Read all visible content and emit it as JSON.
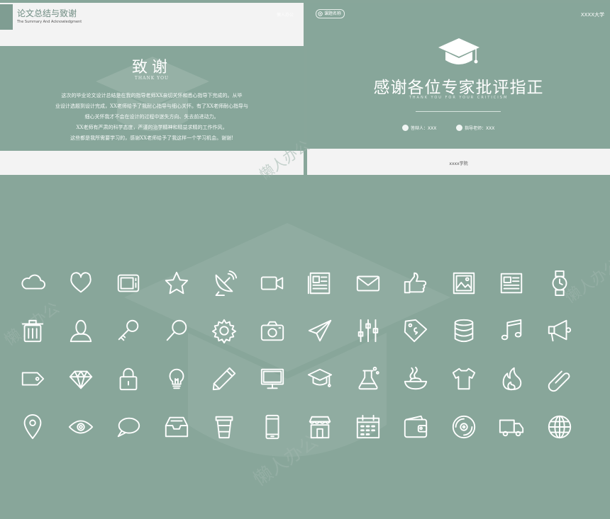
{
  "left_slide": {
    "title": "论文总结与致谢",
    "subtitle": "The Summary And Acknowledgment",
    "corner_tag": "懒人办公",
    "heading": "致谢",
    "heading_en": "THANK YOU",
    "body_lines": [
      "这次的毕业论文设计总结是在我的指导老师XX亲切关怀和悉心指导下完成的。从毕",
      "业设计选题到设计完成，XX老师给予了我耐心指导与细心关怀。有了XX老师耐心指导与",
      "细心关怀我才不会在设计的过程中迷失方向、失去前进动力。",
      "XX老师有严肃的科学态度，严谨的治学精神和精益求精的工作作风，",
      "这些都是我所需要学习的，感谢XX老师给予了我这样一个学习机会。谢谢!"
    ]
  },
  "right_slide": {
    "tag": "课题名称",
    "university": "XXXX大学",
    "title": "感谢各位专家批评指正",
    "subtitle_en": "THANK YOU FOR YOUR CRITICISM",
    "presenter": "答辩人：XXX",
    "advisor": "指导老师：XXX",
    "school": "xxxx学院"
  },
  "watermark_text": "懒人办公",
  "icons": [
    [
      "cloud-icon",
      "heart-icon",
      "tv-icon",
      "star-icon",
      "satellite-dish-icon",
      "video-camera-icon",
      "newspaper-icon",
      "envelope-icon",
      "thumbs-up-icon",
      "picture-icon",
      "document-icon",
      "wristwatch-icon"
    ],
    [
      "trash-icon",
      "user-icon",
      "key-icon",
      "magnifier-icon",
      "gear-icon",
      "camera-icon",
      "paper-plane-icon",
      "sliders-icon",
      "price-tag-icon",
      "database-icon",
      "music-icon",
      "megaphone-icon"
    ],
    [
      "tag-icon",
      "diamond-icon",
      "lock-icon",
      "lightbulb-icon",
      "pencil-icon",
      "monitor-icon",
      "graduation-cap-icon",
      "flask-icon",
      "noodle-bowl-icon",
      "t-shirt-icon",
      "fire-icon",
      "paperclip-icon"
    ],
    [
      "map-pin-icon",
      "eye-icon",
      "speech-bubble-icon",
      "inbox-icon",
      "coffee-cup-icon",
      "smartphone-icon",
      "shop-icon",
      "calendar-icon",
      "wallet-icon",
      "vinyl-disc-icon",
      "delivery-truck-icon",
      "globe-icon"
    ]
  ],
  "colors": {
    "background": "#88a69a",
    "slide_green": "#87a69a",
    "panel": "#f3f3f3",
    "accent": "#7f9d92",
    "icon_stroke": "#ffffff"
  }
}
